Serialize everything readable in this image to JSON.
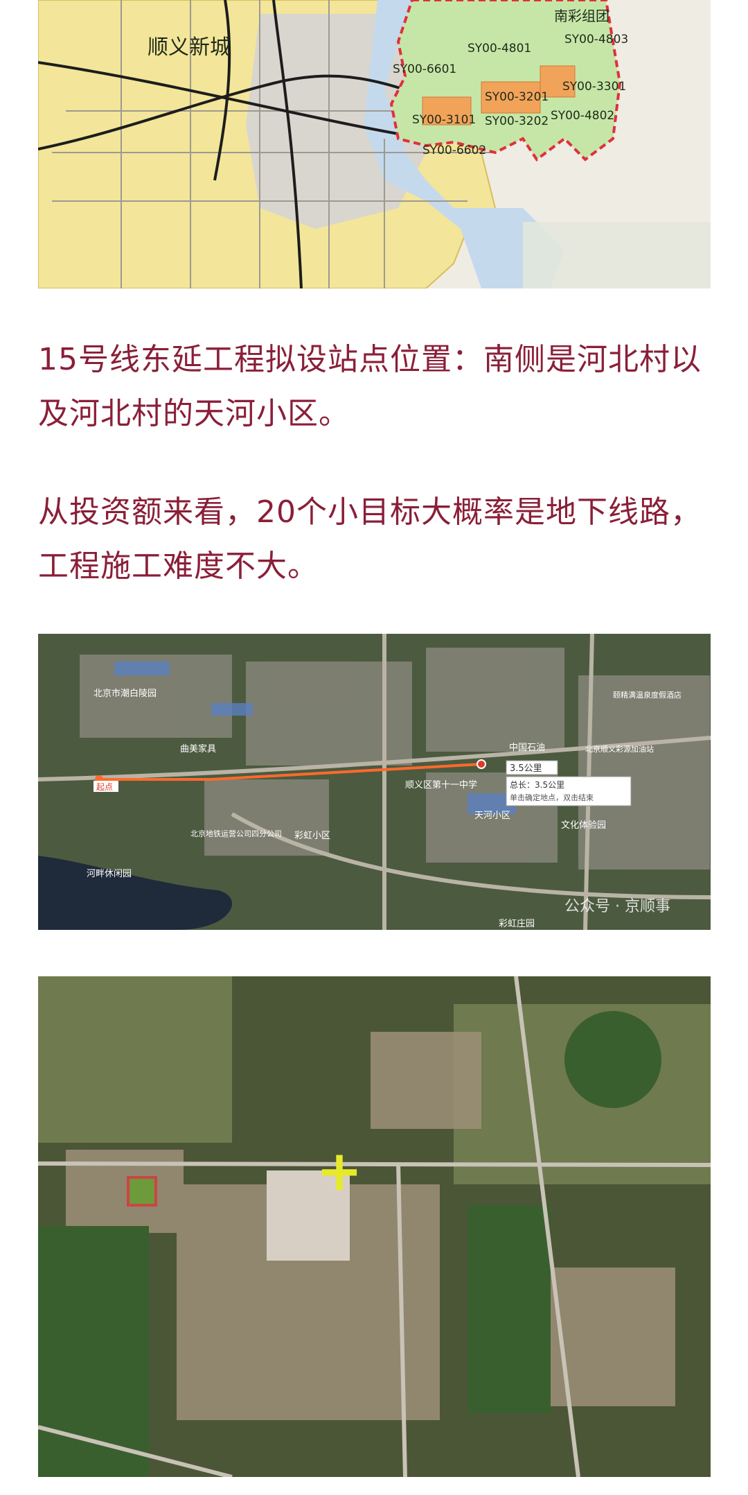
{
  "planning_map": {
    "district_label": "顺义新城",
    "group_label": "南彩组团",
    "parcels": [
      "SY00-4801",
      "SY00-4803",
      "SY00-6601",
      "SY00-3201",
      "SY00-3301",
      "SY00-3101",
      "SY00-3202",
      "SY00-4802",
      "SY00-6602"
    ],
    "colors": {
      "district_fill": "#f3e59a",
      "boundary": "#e0303a",
      "parcel_fill": "#c6e6a8",
      "water": "#c4d9ec"
    }
  },
  "paragraphs": {
    "p1": " 15号线东延工程拟设站点位置：南侧是河北村以及河北村的天河小区。",
    "p2": " 从投资额来看，20个小目标大概率是地下线路，工程施工难度不大。"
  },
  "satellite_map": {
    "poi": {
      "p1": "北京市潮白陵园",
      "p2": "曲美家具",
      "p3": "中国石油",
      "p4": "北京顺义彩源加油站",
      "p5": "颐精满温泉度假酒店",
      "p6": "顺义区第十一中学",
      "p7": "天河小区",
      "p8": "文化体验园",
      "p9": "北京地铁运营公司四分公司",
      "p10": "彩虹小区",
      "p11": "彩虹庄园",
      "p12": "河畔休闲园"
    },
    "start_label": "起点",
    "distance_label": "3.5公里",
    "tooltip_total": "总长：3.5公里",
    "tooltip_hint": "单击确定地点，双击结束",
    "watermark": "公众号 · 京顺事",
    "colors": {
      "route": "#ff6a2b"
    }
  },
  "aerial_map": {
    "marker": "+",
    "colors": {
      "marker": "#e7ea2a"
    }
  }
}
